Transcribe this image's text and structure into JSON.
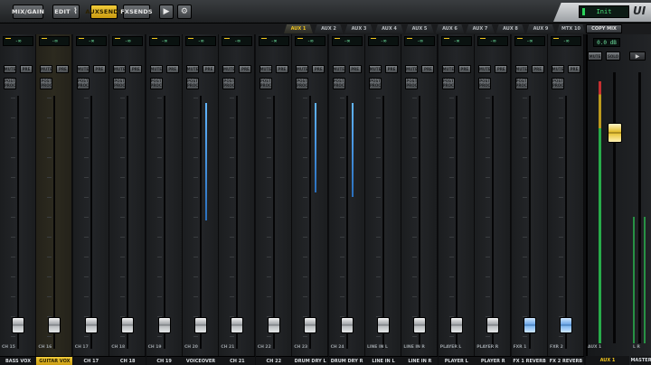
{
  "toolbar": {
    "mix_gain": "MIX/GAIN",
    "edit": "EDIT",
    "aux_sends": "AUXSENDS",
    "fx_sends": "FXSENDS",
    "lcd_value": "Init",
    "brand": "UI"
  },
  "aux_tabs": [
    "AUX 1",
    "AUX 2",
    "AUX 3",
    "AUX 4",
    "AUX 5",
    "AUX 6",
    "AUX 7",
    "AUX 8",
    "AUX 9",
    "MTX 10"
  ],
  "copy_mix": "COPY MIX",
  "channels": [
    {
      "num": "CH 15",
      "name": "BASS VOX",
      "gain": "-∞",
      "level": 0.05,
      "meter": 0.0,
      "fx": false,
      "sel": false
    },
    {
      "num": "CH 16",
      "name": "GUITAR VOX",
      "gain": "-∞",
      "level": 0.05,
      "meter": 0.0,
      "fx": false,
      "sel": true
    },
    {
      "num": "CH 17",
      "name": "CH 17",
      "gain": "-∞",
      "level": 0.05,
      "meter": 0.0,
      "fx": false,
      "sel": false
    },
    {
      "num": "CH 18",
      "name": "CH 18",
      "gain": "-∞",
      "level": 0.05,
      "meter": 0.0,
      "fx": false,
      "sel": false
    },
    {
      "num": "CH 19",
      "name": "CH 19",
      "gain": "-∞",
      "level": 0.05,
      "meter": 0.0,
      "fx": false,
      "sel": false
    },
    {
      "num": "CH 20",
      "name": "VOICEOVER",
      "gain": "-∞",
      "level": 0.05,
      "meter": 0.72,
      "fx": false,
      "sel": false
    },
    {
      "num": "CH 21",
      "name": "CH 21",
      "gain": "-∞",
      "level": 0.05,
      "meter": 0.0,
      "fx": false,
      "sel": false
    },
    {
      "num": "CH 22",
      "name": "CH 22",
      "gain": "-∞",
      "level": 0.05,
      "meter": 0.0,
      "fx": false,
      "sel": false
    },
    {
      "num": "CH 23",
      "name": "DRUM DRY L",
      "gain": "-∞",
      "level": 0.05,
      "meter": 0.55,
      "fx": false,
      "sel": false
    },
    {
      "num": "CH 24",
      "name": "DRUM DRY R",
      "gain": "-∞",
      "level": 0.05,
      "meter": 0.58,
      "fx": false,
      "sel": false
    },
    {
      "num": "LINE IN L",
      "name": "LINE IN L",
      "gain": "-∞",
      "level": 0.05,
      "meter": 0.0,
      "fx": false,
      "sel": false
    },
    {
      "num": "LINE IN R",
      "name": "LINE IN R",
      "gain": "-∞",
      "level": 0.05,
      "meter": 0.0,
      "fx": false,
      "sel": false
    },
    {
      "num": "PLAYER L",
      "name": "PLAYER L",
      "gain": "-∞",
      "level": 0.05,
      "meter": 0.0,
      "fx": false,
      "sel": false
    },
    {
      "num": "PLAYER R",
      "name": "PLAYER R",
      "gain": "-∞",
      "level": 0.05,
      "meter": 0.0,
      "fx": false,
      "sel": false
    },
    {
      "num": "FXR 1",
      "name": "FX 1 REVERB",
      "gain": "-∞",
      "level": 0.05,
      "meter": 0.0,
      "fx": true,
      "sel": false
    },
    {
      "num": "FXR 2",
      "name": "FX 2 REVERB",
      "gain": "-∞",
      "level": 0.05,
      "meter": 0.0,
      "fx": true,
      "sel": false
    }
  ],
  "strip_buttons": {
    "mute": "MUTE",
    "pre": "PRE",
    "post1": "POST",
    "post2": "PROC"
  },
  "master": {
    "level": "0.0 dB",
    "mute": "MUTE",
    "solo": "SOLO",
    "play": "▶",
    "num": "AUX 1",
    "name": "AUX 1",
    "fader_level": 0.8,
    "main_num": "L  R",
    "main_name": "MASTER"
  }
}
